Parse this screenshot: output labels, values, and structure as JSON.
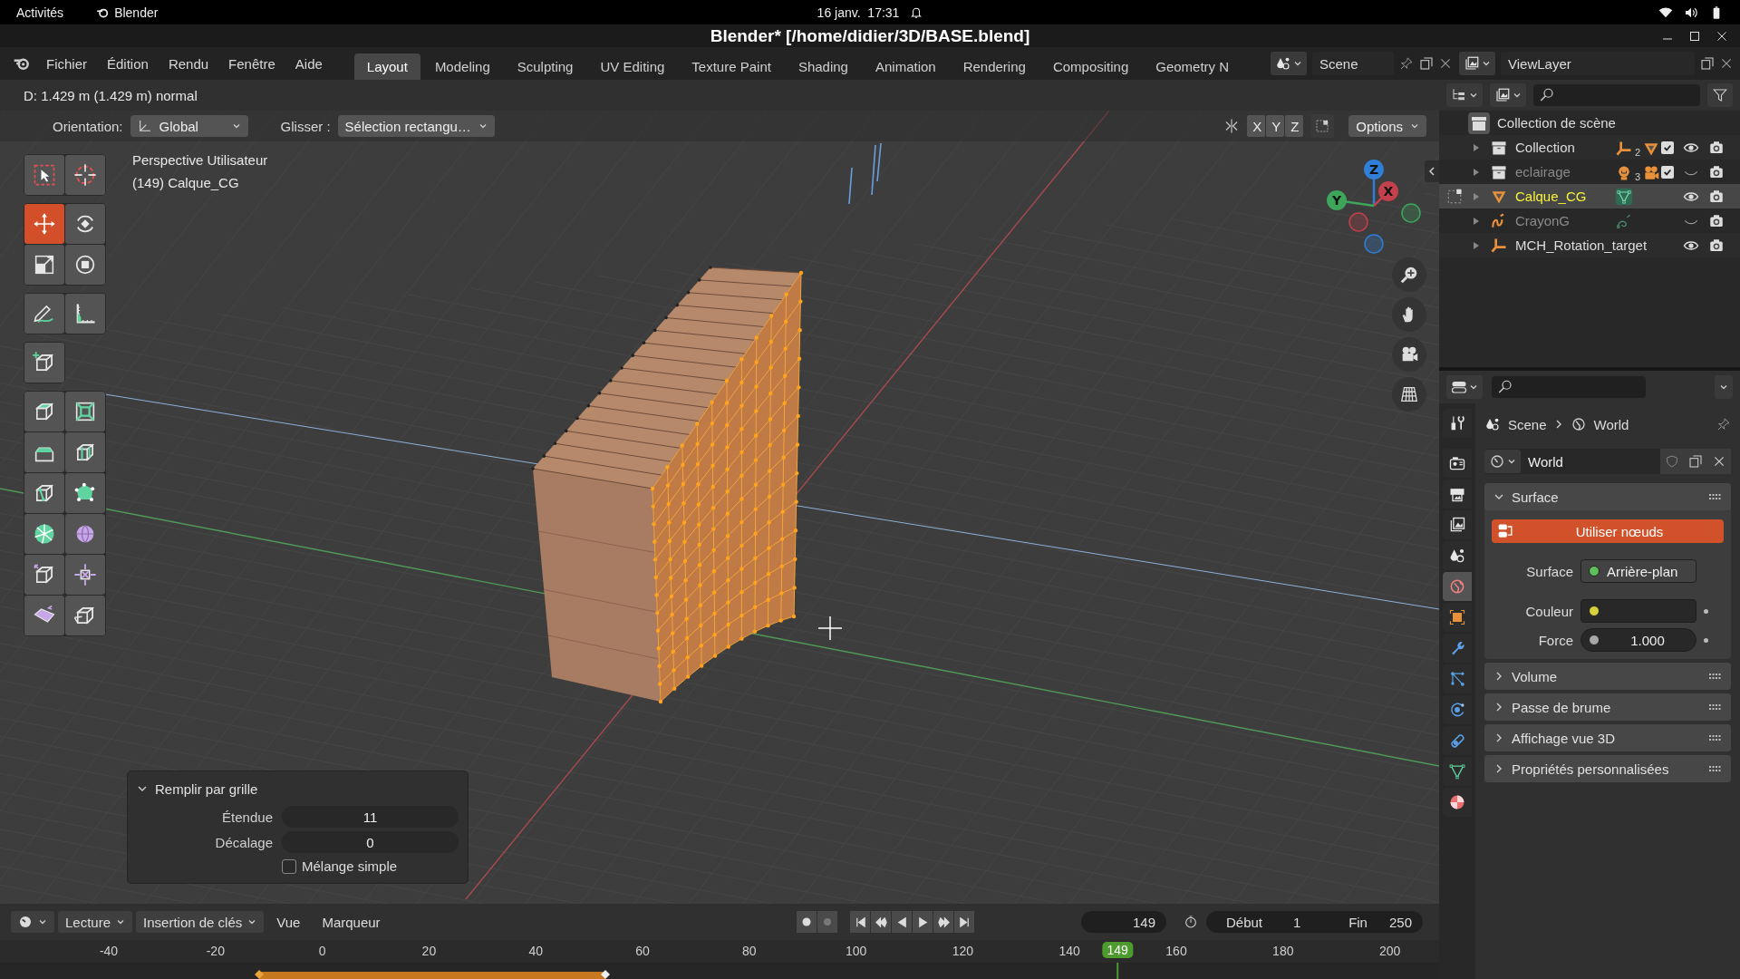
{
  "system_bar": {
    "activities": "Activités",
    "app": "Blender",
    "clock": "16 janv.  17:31"
  },
  "window": {
    "title": "Blender* [/home/didier/3D/BASE.blend]"
  },
  "menu": [
    "Fichier",
    "Édition",
    "Rendu",
    "Fenêtre",
    "Aide"
  ],
  "workspaces": [
    {
      "label": "Layout",
      "selected": true
    },
    {
      "label": "Modeling",
      "selected": false
    },
    {
      "label": "Sculpting",
      "selected": false
    },
    {
      "label": "UV Editing",
      "selected": false
    },
    {
      "label": "Texture Paint",
      "selected": false
    },
    {
      "label": "Shading",
      "selected": false
    },
    {
      "label": "Animation",
      "selected": false
    },
    {
      "label": "Rendering",
      "selected": false
    },
    {
      "label": "Compositing",
      "selected": false
    },
    {
      "label": "Geometry N",
      "selected": false
    }
  ],
  "scene": {
    "name": "Scene"
  },
  "view_layer": {
    "name": "ViewLayer"
  },
  "viewport": {
    "status": "D: 1.429 m (1.429 m) normal",
    "orientation_label": "Orientation:",
    "orientation": "Global",
    "drag_label": "Glisser :",
    "drag": "Sélection rectangu…",
    "mirror_axes": [
      {
        "label": "X",
        "selected": false
      },
      {
        "label": "Y",
        "selected": false
      },
      {
        "label": "Z",
        "selected": false
      }
    ],
    "options": "Options",
    "view_name": "Perspective Utilisateur",
    "object_info": "(149) Calque_CG",
    "tool_groups": [
      [
        {
          "kind": "select-box",
          "selected": false
        },
        {
          "kind": "cursor",
          "selected": false
        }
      ],
      [
        {
          "kind": "move",
          "selected": true
        },
        {
          "kind": "rotate",
          "selected": false
        },
        {
          "kind": "scale",
          "selected": false
        },
        {
          "kind": "transform",
          "selected": false
        }
      ],
      [
        {
          "kind": "annotate",
          "selected": false
        },
        {
          "kind": "measure",
          "selected": false
        }
      ],
      [
        {
          "kind": "add-cube",
          "selected": false
        }
      ],
      [
        {
          "kind": "extrude",
          "selected": false
        },
        {
          "kind": "inset",
          "selected": false
        },
        {
          "kind": "bevel",
          "selected": false
        },
        {
          "kind": "loop-cut",
          "selected": false
        },
        {
          "kind": "knife",
          "selected": false
        },
        {
          "kind": "poly-build",
          "selected": false
        },
        {
          "kind": "spin",
          "selected": false
        },
        {
          "kind": "smooth",
          "selected": false
        },
        {
          "kind": "edge-slide",
          "selected": false
        },
        {
          "kind": "shrink",
          "selected": false
        },
        {
          "kind": "shear",
          "selected": false
        },
        {
          "kind": "rip",
          "selected": false
        }
      ]
    ],
    "gizmo_axes": [
      {
        "label": "Z",
        "color": "#2f7fd8"
      },
      {
        "label": "X",
        "color": "#c2414d"
      },
      {
        "label": "Y",
        "color": "#3da65a"
      }
    ],
    "operator_panel": {
      "title": "Remplir par grille",
      "expanded": true,
      "fields": [
        {
          "label": "Étendue",
          "value": "11"
        },
        {
          "label": "Décalage",
          "value": "0"
        }
      ],
      "checkbox": {
        "label": "Mélange simple",
        "checked": false
      }
    }
  },
  "outliner": {
    "root": "Collection de scène",
    "rows": [
      {
        "name": "Collection",
        "kind": "collection",
        "selected": false,
        "edit_mode": false,
        "visible": true,
        "checked": true,
        "badges": [
          {
            "kind": "armature",
            "count": "2"
          },
          {
            "kind": "mesh"
          }
        ]
      },
      {
        "name": "eclairage",
        "kind": "collection",
        "selected": false,
        "edit_mode": false,
        "visible": false,
        "checked": true,
        "badges": [
          {
            "kind": "light",
            "count": "3"
          },
          {
            "kind": "camera"
          }
        ]
      },
      {
        "name": "Calque_CG",
        "kind": "mesh",
        "selected": true,
        "edit_mode": true,
        "visible": true,
        "badges": [
          {
            "kind": "mesh-data"
          }
        ]
      },
      {
        "name": "CrayonG",
        "kind": "grease-pencil",
        "selected": false,
        "edit_mode": false,
        "visible": false,
        "badges": [
          {
            "kind": "stroke-data"
          }
        ]
      },
      {
        "name": "MCH_Rotation_target",
        "kind": "armature",
        "selected": false,
        "edit_mode": false,
        "visible": true,
        "badges": []
      }
    ]
  },
  "properties": {
    "breadcrumb": [
      "Scene",
      "World"
    ],
    "world_name": "World",
    "tabs": [
      {
        "kind": "tool",
        "selected": false
      },
      {
        "kind": "render",
        "selected": false
      },
      {
        "kind": "output",
        "selected": false
      },
      {
        "kind": "view-layer",
        "selected": false
      },
      {
        "kind": "scene",
        "selected": false
      },
      {
        "kind": "world",
        "selected": true
      },
      {
        "kind": "object",
        "selected": false
      },
      {
        "kind": "modifier",
        "selected": false
      },
      {
        "kind": "particles",
        "selected": false
      },
      {
        "kind": "physics",
        "selected": false
      },
      {
        "kind": "constraints",
        "selected": false
      },
      {
        "kind": "data",
        "selected": false
      },
      {
        "kind": "material",
        "selected": false
      }
    ],
    "panels": [
      {
        "title": "Surface",
        "expanded": true,
        "use_nodes": "Utiliser nœuds",
        "fields": [
          {
            "kind": "shader",
            "label": "Surface",
            "value": "Arrière-plan",
            "color": "#5dc05a"
          },
          {
            "kind": "color",
            "label": "Couleur",
            "color": "#d6d23c"
          },
          {
            "kind": "number",
            "label": "Force",
            "value": "1.000",
            "color": "#a8a8a8"
          }
        ]
      },
      {
        "title": "Volume",
        "expanded": false
      },
      {
        "title": "Passe de brume",
        "expanded": false
      },
      {
        "title": "Affichage vue 3D",
        "expanded": false
      },
      {
        "title": "Propriétés personnalisées",
        "expanded": false
      }
    ]
  },
  "timeline": {
    "playback": "Lecture",
    "keying": "Insertion de clés",
    "menus": [
      "Vue",
      "Marqueur"
    ],
    "current_frame": "149",
    "start_label": "Début",
    "start": "1",
    "end_label": "Fin",
    "end": "250",
    "ruler": [
      "-40",
      "-20",
      "0",
      "20",
      "40",
      "60",
      "80",
      "100",
      "120",
      "140",
      "160",
      "180",
      "200"
    ],
    "ruler_frame": "149"
  }
}
